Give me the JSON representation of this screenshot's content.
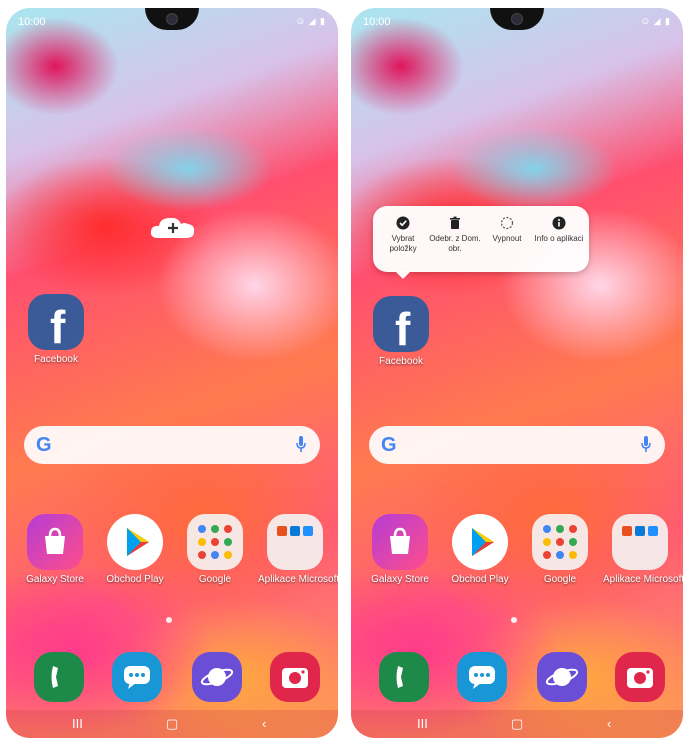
{
  "status": {
    "time": "10:00",
    "icons": "⊙ ◢ ▮"
  },
  "apps": {
    "facebook": "Facebook",
    "galaxy_store": "Galaxy Store",
    "obchod_play": "Obchod Play",
    "google": "Google",
    "microsoft": "Aplikace Microsoft"
  },
  "search": {
    "logo": "G"
  },
  "context_menu": {
    "items": [
      {
        "label": "Vybrat položky",
        "icon": "check-circle-icon"
      },
      {
        "label": "Odebr. z Dom. obr.",
        "icon": "trash-icon"
      },
      {
        "label": "Vypnout",
        "icon": "dashed-circle-icon"
      },
      {
        "label": "Info o aplikaci",
        "icon": "info-icon"
      }
    ]
  },
  "nav": {
    "recent": "III",
    "home": "▢",
    "back": "‹"
  },
  "colors": {
    "facebook": "#3b5b98",
    "dialer": "#1e8a4a",
    "messages": "#1996d6",
    "internet": "#6a4fd6",
    "camera": "#e1264b"
  }
}
